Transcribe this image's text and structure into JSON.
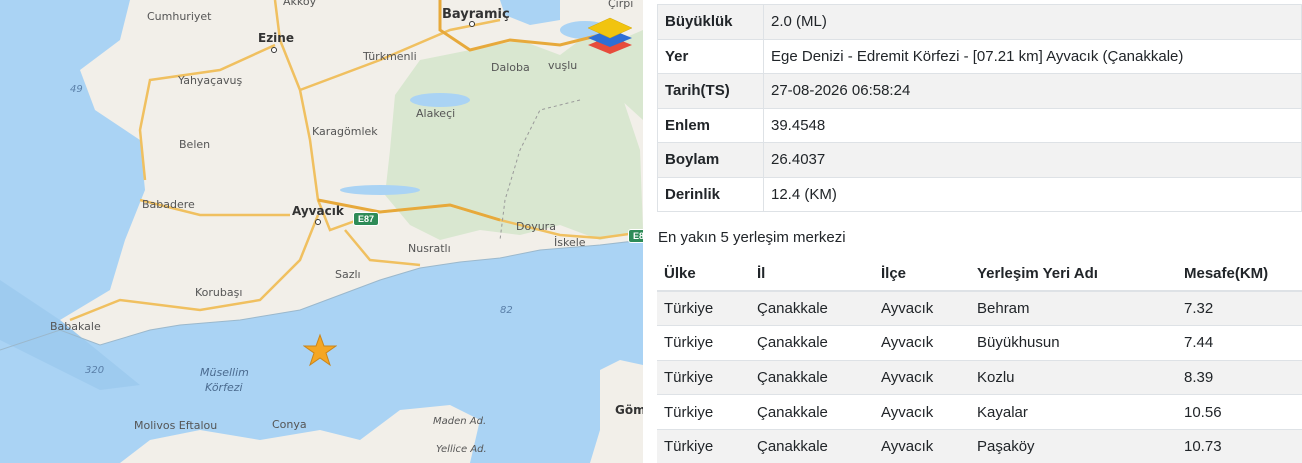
{
  "map": {
    "labels": {
      "cumhuriyet": "Cumhuriyet",
      "akkoy": "Akköy",
      "bayramic": "Bayramiç",
      "cirpi": "Çırpı",
      "ezine": "Ezine",
      "turkmenli": "Türkmenli",
      "daloba": "Daloba",
      "vuslu": "vuşlu",
      "yahyacavus": "Yahyaçavuş",
      "alakeci": "Alakeçi",
      "karagomlek": "Karagömlek",
      "belen": "Belen",
      "babadere": "Babadere",
      "ayvacik": "Ayvacık",
      "e87_a": "E87",
      "e87_b": "E8",
      "doyuran": "Doyura",
      "iskele": "İskele",
      "nusratli": "Nusratlı",
      "sazli": "Sazlı",
      "korubasi": "Korubaşı",
      "babakale": "Babakale",
      "depth_49": "49",
      "depth_82": "82",
      "depth_320": "320",
      "musellim": "Müsellim",
      "korfezi": "Körfezi",
      "molivos": "Molivos Eftalou",
      "conya": "Conya",
      "madenad": "Maden Ad.",
      "yelliceAd": "Yellice Ad.",
      "gom": "Göm"
    }
  },
  "details": [
    {
      "key": "Büyüklük",
      "value": "2.0 (ML)"
    },
    {
      "key": "Yer",
      "value": "Ege Denizi - Edremit Körfezi - [07.21 km] Ayvacık (Çanakkale)"
    },
    {
      "key": "Tarih(TS)",
      "value": "27-08-2026 06:58:24"
    },
    {
      "key": "Enlem",
      "value": "39.4548"
    },
    {
      "key": "Boylam",
      "value": "26.4037"
    },
    {
      "key": "Derinlik",
      "value": "12.4 (KM)"
    }
  ],
  "nearest": {
    "title": "En yakın 5 yerleşim merkezi",
    "headers": [
      "Ülke",
      "İl",
      "İlçe",
      "Yerleşim Yeri Adı",
      "Mesafe(KM)"
    ],
    "rows": [
      [
        "Türkiye",
        "Çanakkale",
        "Ayvacık",
        "Behram",
        "7.32"
      ],
      [
        "Türkiye",
        "Çanakkale",
        "Ayvacık",
        "Büyükhusun",
        "7.44"
      ],
      [
        "Türkiye",
        "Çanakkale",
        "Ayvacık",
        "Kozlu",
        "8.39"
      ],
      [
        "Türkiye",
        "Çanakkale",
        "Ayvacık",
        "Kayalar",
        "10.56"
      ],
      [
        "Türkiye",
        "Çanakkale",
        "Ayvacık",
        "Paşaköy",
        "10.73"
      ]
    ]
  },
  "colors": {
    "sea": "#aad3f4",
    "land": "#f2efe9",
    "forest": "#d9e7d0",
    "road": "#f0c060",
    "epicenter_star": "#f5a623"
  }
}
